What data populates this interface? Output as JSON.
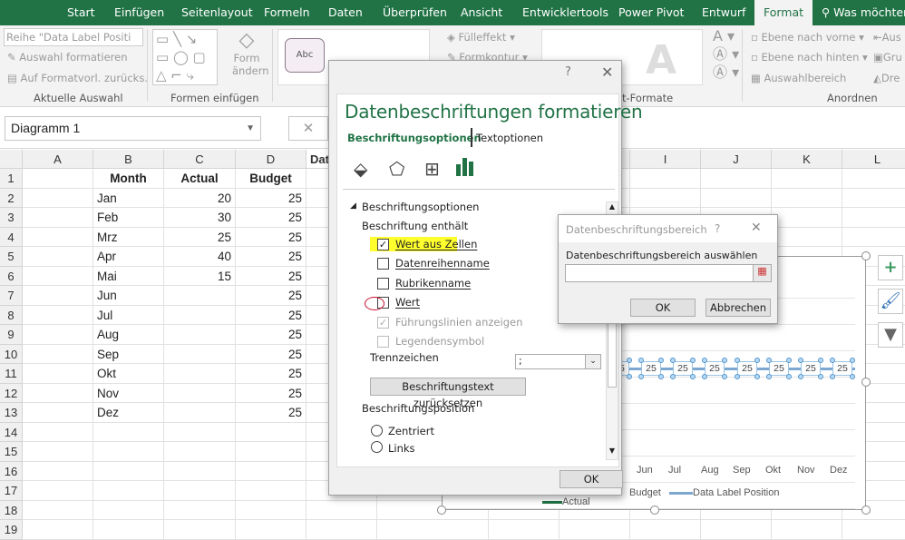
{
  "ribbon": {
    "tabs": [
      "Start",
      "Einfügen",
      "Seitenlayout",
      "Formeln",
      "Daten",
      "Überprüfen",
      "Ansicht",
      "Entwicklertools",
      "Power Pivot",
      "Entwurf",
      "Format"
    ],
    "active_tab": "Format",
    "tell_me": "Was möchten",
    "selection_dropdown": "Reihe \"Data Label Position\"",
    "format_selection": "Auswahl formatieren",
    "reset_style": "Auf Formatvorl. zurücks.",
    "group_current": "Aktuelle Auswahl",
    "change_shape": "Form",
    "change_shape2": "ändern",
    "group_insert_shapes": "Formen einfügen",
    "style_sample": "Abc",
    "fill": "Fülleffekt",
    "outline": "Formkontur",
    "wordart_group": "t-Formate",
    "bring_forward": "Ebene nach vorne",
    "send_backward": "Ebene nach hinten",
    "selection_pane": "Auswahlbereich",
    "align": "Aus",
    "group": "Gru",
    "rotate": "Dre",
    "group_arrange": "Anordnen"
  },
  "namebox": "Diagramm 1",
  "columns": [
    "A",
    "B",
    "C",
    "D",
    "Data",
    "",
    "",
    "",
    "I",
    "J",
    "K",
    "L"
  ],
  "rows": [
    "1",
    "2",
    "3",
    "4",
    "5",
    "6",
    "7",
    "8",
    "9",
    "10",
    "11",
    "12",
    "13",
    "14",
    "15",
    "16",
    "17",
    "18",
    "19"
  ],
  "table": {
    "headers": [
      "Month",
      "Actual",
      "Budget"
    ],
    "rows": [
      [
        "Jan",
        "20",
        "25"
      ],
      [
        "Feb",
        "30",
        "25"
      ],
      [
        "Mrz",
        "25",
        "25"
      ],
      [
        "Apr",
        "40",
        "25"
      ],
      [
        "Mai",
        "15",
        "25"
      ],
      [
        "Jun",
        "",
        "25"
      ],
      [
        "Jul",
        "",
        "25"
      ],
      [
        "Aug",
        "",
        "25"
      ],
      [
        "Sep",
        "",
        "25"
      ],
      [
        "Okt",
        "",
        "25"
      ],
      [
        "Nov",
        "",
        "25"
      ],
      [
        "Dez",
        "",
        "25"
      ]
    ]
  },
  "chart": {
    "x_labels": [
      "Jun",
      "Jul",
      "Aug",
      "Sep",
      "Okt",
      "Nov",
      "Dez"
    ],
    "data_label": "25",
    "partial_label": "25",
    "legend": [
      "Actual",
      "Budget",
      "Data Label Position"
    ],
    "series_color": "#7ba7d0"
  },
  "pane": {
    "help": "?",
    "title": "Datenbeschriftungen formatieren",
    "tab1": "Beschriftungsoptionen",
    "tab2": "Textoptionen",
    "section": "Beschriftungsoptionen",
    "contains": "Beschriftung enthält",
    "options": [
      {
        "label": "Wert aus Zellen",
        "checked": true
      },
      {
        "label": "Datenreihenname",
        "checked": false
      },
      {
        "label": "Rubrikenname",
        "checked": false
      },
      {
        "label": "Wert",
        "checked": false
      },
      {
        "label": "Führungslinien anzeigen",
        "checked": true,
        "disabled": true
      },
      {
        "label": "Legendensymbol",
        "checked": false,
        "disabled": true
      }
    ],
    "separator_label": "Trennzeichen",
    "separator_value": ";",
    "reset_button": "Beschriftungstext zurücksetzen",
    "position_label": "Beschriftungsposition",
    "positions": [
      "Zentriert",
      "Links"
    ],
    "ok": "OK",
    "accent": "#217346"
  },
  "range_dialog": {
    "title": "Datenbeschriftungsbereich",
    "help": "?",
    "label": "Datenbeschriftungsbereich auswählen",
    "value": "",
    "ok": "OK",
    "cancel": "Abbrechen"
  }
}
